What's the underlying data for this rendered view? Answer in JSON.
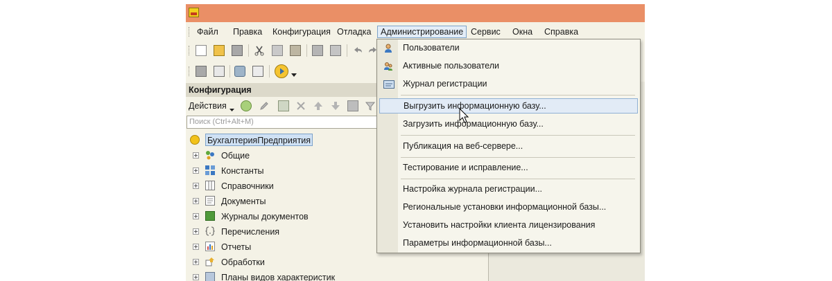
{
  "menu": {
    "items": [
      {
        "label": "Файл"
      },
      {
        "label": "Правка"
      },
      {
        "label": "Конфигурация"
      },
      {
        "label": "Отладка"
      },
      {
        "label": "Администрирование"
      },
      {
        "label": "Сервис"
      },
      {
        "label": "Окна"
      },
      {
        "label": "Справка"
      }
    ]
  },
  "panel": {
    "title": "Конфигурация",
    "actions_label": "Действия",
    "search_placeholder": "Поиск (Ctrl+Alt+M)"
  },
  "tree": {
    "root": "БухгалтерияПредприятия",
    "items": [
      {
        "label": "Общие",
        "icon": "common-icon"
      },
      {
        "label": "Константы",
        "icon": "constants-icon"
      },
      {
        "label": "Справочники",
        "icon": "catalogs-icon"
      },
      {
        "label": "Документы",
        "icon": "documents-icon"
      },
      {
        "label": "Журналы документов",
        "icon": "document-journals-icon"
      },
      {
        "label": "Перечисления",
        "icon": "enumerations-icon"
      },
      {
        "label": "Отчеты",
        "icon": "reports-icon"
      },
      {
        "label": "Обработки",
        "icon": "data-processors-icon"
      },
      {
        "label": "Планы видов характеристик",
        "icon": "characteristic-types-icon"
      }
    ]
  },
  "dropdown": {
    "items": [
      {
        "label": "Пользователи",
        "icon": "users-icon"
      },
      {
        "label": "Активные пользователи",
        "icon": "active-users-icon"
      },
      {
        "label": "Журнал регистрации",
        "icon": "event-log-icon"
      },
      {
        "label": "Выгрузить информационную базу..."
      },
      {
        "label": "Загрузить информационную базу..."
      },
      {
        "label": "Публикация на веб-сервере..."
      },
      {
        "label": "Тестирование и исправление..."
      },
      {
        "label": "Настройка журнала регистрации..."
      },
      {
        "label": "Региональные установки информационной базы..."
      },
      {
        "label": "Установить настройки клиента лицензирования"
      },
      {
        "label": "Параметры информационной базы..."
      }
    ],
    "hover_item": "Выгрузить информационную базу..."
  },
  "colors": {
    "titlebar": "#ea8f66",
    "background": "#f4f2e6",
    "highlight": "#e2ebf6",
    "highlight_border": "#8fb0d4"
  }
}
